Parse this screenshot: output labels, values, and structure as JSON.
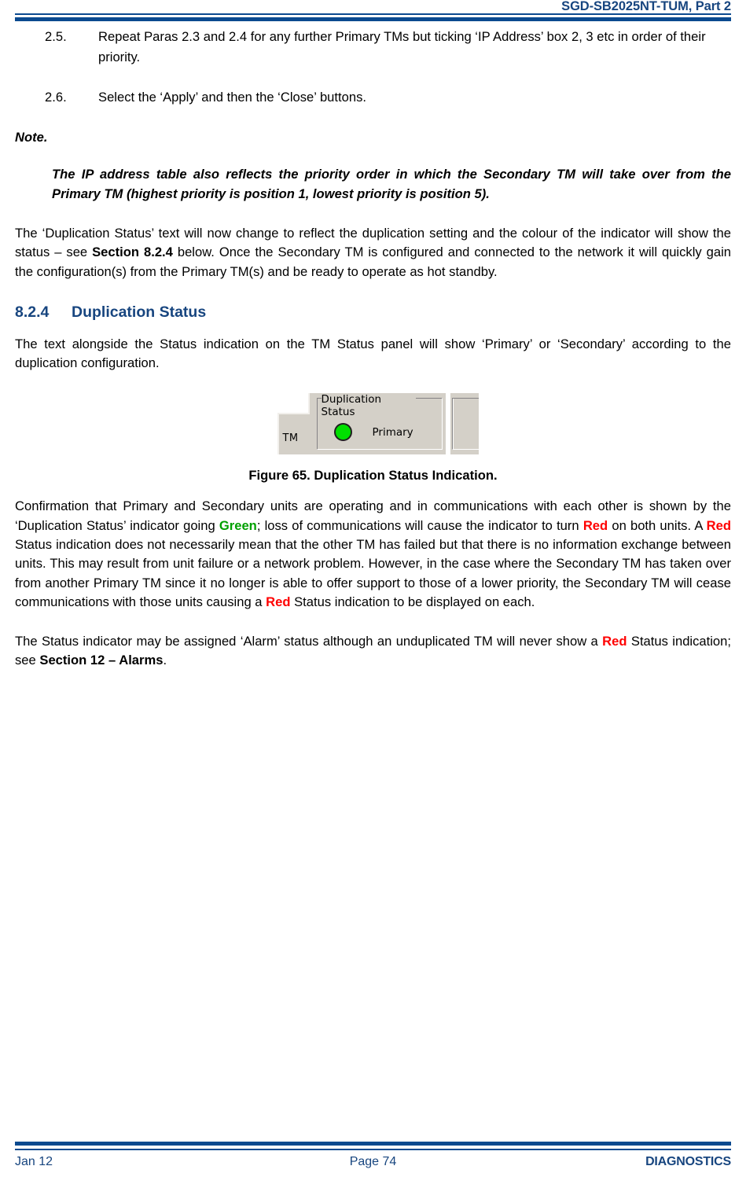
{
  "header": {
    "document_title": "SGD-SB2025NT-TUM, Part 2"
  },
  "footer": {
    "date": "Jan 12",
    "page": "Page 74",
    "company": "DIAGNOSTICS"
  },
  "colors": {
    "brand_blue": "#17457f",
    "rule_blue": "#0b4a8f",
    "status_green": "#00a000",
    "status_red": "#ff0000",
    "led_green": "#00e000",
    "window_face": "#d4d0c8"
  },
  "list": {
    "items": [
      {
        "number": "2.5.",
        "text": "Repeat Paras 2.3 and 2.4 for any further Primary TMs but ticking ‘IP Address’ box 2, 3 etc in order of their priority."
      },
      {
        "number": "2.6.",
        "text": "Select the ‘Apply’ and then the ‘Close’ buttons."
      }
    ]
  },
  "note": {
    "label": "Note.",
    "body": "The IP address table also reflects the priority order in which the Secondary TM will take over from the Primary TM (highest priority is position 1, lowest priority is position 5)."
  },
  "paragraphs": {
    "intro_1": "The ‘Duplication Status’ text will now change to reflect the duplication setting and the colour of the indicator will show the status – see ",
    "intro_ref": "Section 8.2.4",
    "intro_2": " below.  Once the Secondary TM is configured and connected to the network it will quickly gain the configuration(s) from the Primary TM(s) and be ready to operate as hot standby.",
    "after_head": "The text alongside the Status indication on the TM Status panel will show ‘Primary’ or ‘Secondary’ according to the duplication configuration.",
    "conf_1": "Confirmation that Primary and Secondary units are operating and in communications with each other is shown by the ‘Duplication Status’ indicator going ",
    "conf_green": "Green",
    "conf_2": "; loss of communications will cause the indicator to turn ",
    "conf_red1": "Red",
    "conf_3": " on both units.  A ",
    "conf_red2": "Red",
    "conf_4": " Status indication does not necessarily mean that the other TM has failed but that there is no information exchange between units.  This may result from unit failure or a network problem.  However, in the case where the Secondary TM has taken over from another Primary TM since it no longer is able to offer support to those of a lower priority, the Secondary TM will cease communications with those units causing a ",
    "conf_red3": "Red",
    "conf_5": " Status indication to be displayed on each.",
    "alarm_1": "The Status indicator may be assigned ‘Alarm’ status although an unduplicated TM will never show a ",
    "alarm_red": "Red",
    "alarm_2": " Status indication; see ",
    "alarm_ref": "Section 12 – Alarms",
    "alarm_3": "."
  },
  "section": {
    "number": "8.2.4",
    "title": "Duplication Status"
  },
  "figure": {
    "caption": "Figure 65.  Duplication Status Indication.",
    "screenshot": {
      "tab_label": "TM",
      "group_legend_line1": "Duplication",
      "group_legend_line2": "Status",
      "indicator_state": "green",
      "indicator_text": "Primary"
    }
  }
}
